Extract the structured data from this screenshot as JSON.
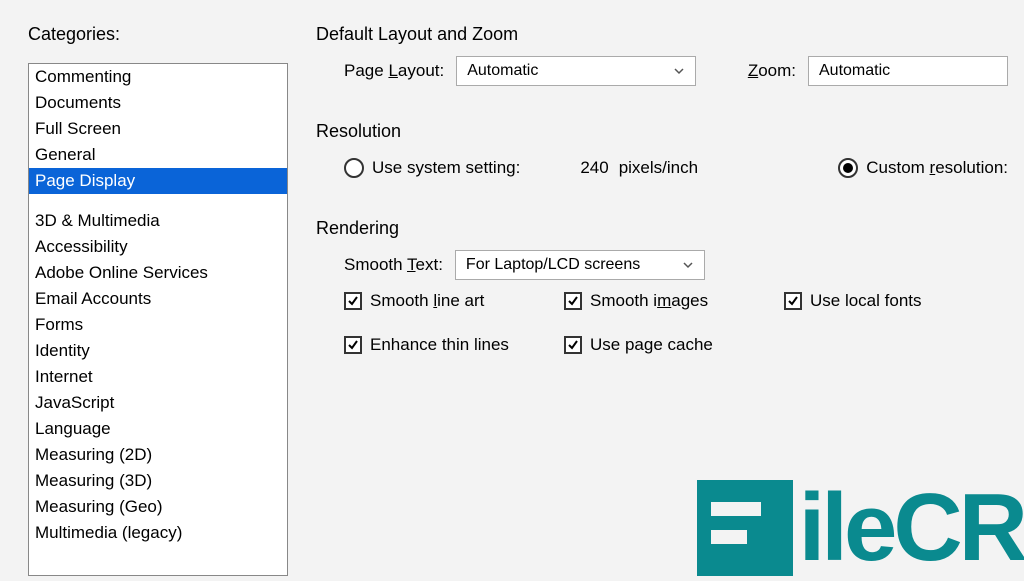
{
  "sidebar": {
    "label": "Categories:",
    "items_top": [
      "Commenting",
      "Documents",
      "Full Screen",
      "General",
      "Page Display"
    ],
    "selected_index": 4,
    "items_bottom": [
      "3D & Multimedia",
      "Accessibility",
      "Adobe Online Services",
      "Email Accounts",
      "Forms",
      "Identity",
      "Internet",
      "JavaScript",
      "Language",
      "Measuring (2D)",
      "Measuring (3D)",
      "Measuring (Geo)",
      "Multimedia (legacy)"
    ]
  },
  "layout_section": {
    "title": "Default Layout and Zoom",
    "page_layout_label": "Page Layout:",
    "page_layout_value": "Automatic",
    "zoom_label": "Zoom:",
    "zoom_value": "Automatic"
  },
  "resolution_section": {
    "title": "Resolution",
    "use_system_label": "Use system setting:",
    "system_value": "240",
    "system_unit": "pixels/inch",
    "custom_label": "Custom resolution:",
    "selected": "custom"
  },
  "rendering_section": {
    "title": "Rendering",
    "smooth_text_label": "Smooth Text:",
    "smooth_text_value": "For Laptop/LCD screens",
    "checks": {
      "smooth_line_art": {
        "label": "Smooth line art",
        "checked": true
      },
      "smooth_images": {
        "label": "Smooth images",
        "checked": true
      },
      "use_local_fonts": {
        "label": "Use local fonts",
        "checked": true
      },
      "enhance_thin": {
        "label": "Enhance thin lines",
        "checked": true
      },
      "use_page_cache": {
        "label": "Use page cache",
        "checked": true
      }
    }
  },
  "watermark": "ileCR"
}
